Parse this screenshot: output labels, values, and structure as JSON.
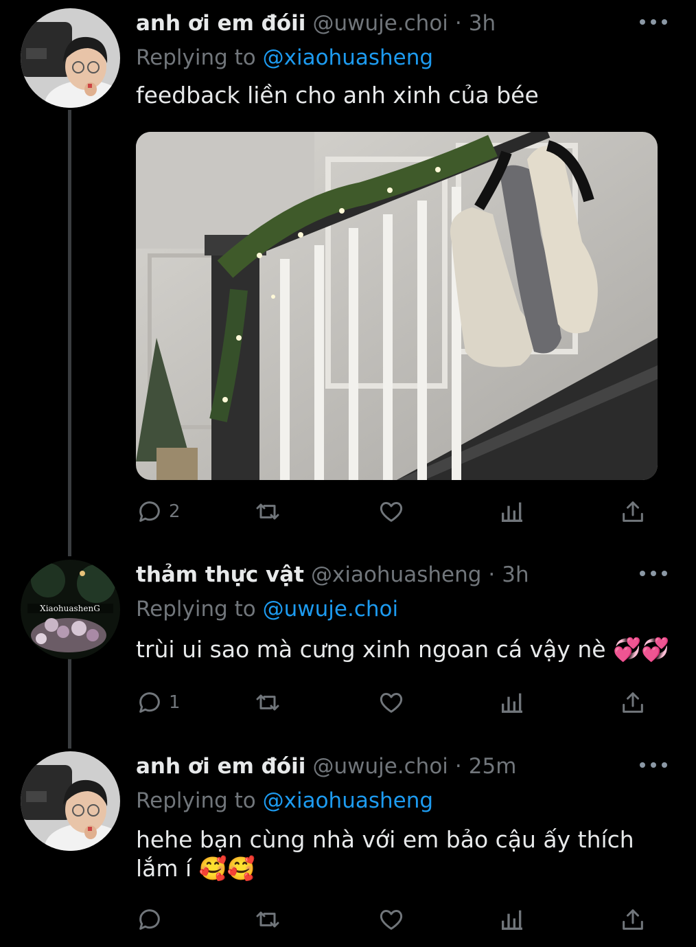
{
  "tweets": [
    {
      "name": "anh ơi em đóii",
      "handle": "@uwuje.choi",
      "sep": "·",
      "time": "3h",
      "replying_prefix": "Replying to",
      "replying_to": "@xiaohuasheng",
      "text": "feedback liền cho anh xinh của bée",
      "replies": "2",
      "retweets": "",
      "likes": ""
    },
    {
      "name": "thảm thực vật",
      "handle": "@xiaohuasheng",
      "sep": "·",
      "time": "3h",
      "replying_prefix": "Replying to",
      "replying_to": "@uwuje.choi",
      "text": "trùi ui sao mà cưng xinh ngoan cá vậy nè 💞💞",
      "replies": "1",
      "avatar_text": "XiaohuashenG",
      "retweets": "",
      "likes": ""
    },
    {
      "name": "anh ơi em đóii",
      "handle": "@uwuje.choi",
      "sep": "·",
      "time": "25m",
      "replying_prefix": "Replying to",
      "replying_to": "@xiaohuasheng",
      "text": "hehe bạn cùng nhà với em bảo cậu ấy thích lắm í 🥰🥰",
      "replies": "",
      "retweets": "",
      "likes": ""
    }
  ],
  "icons": {
    "reply": "reply-icon",
    "retweet": "retweet-icon",
    "like": "heart-icon",
    "views": "views-icon",
    "share": "share-icon",
    "more": "more-icon"
  },
  "colors": {
    "background": "#000000",
    "accent": "#1d9bf0",
    "muted": "#71767b"
  }
}
